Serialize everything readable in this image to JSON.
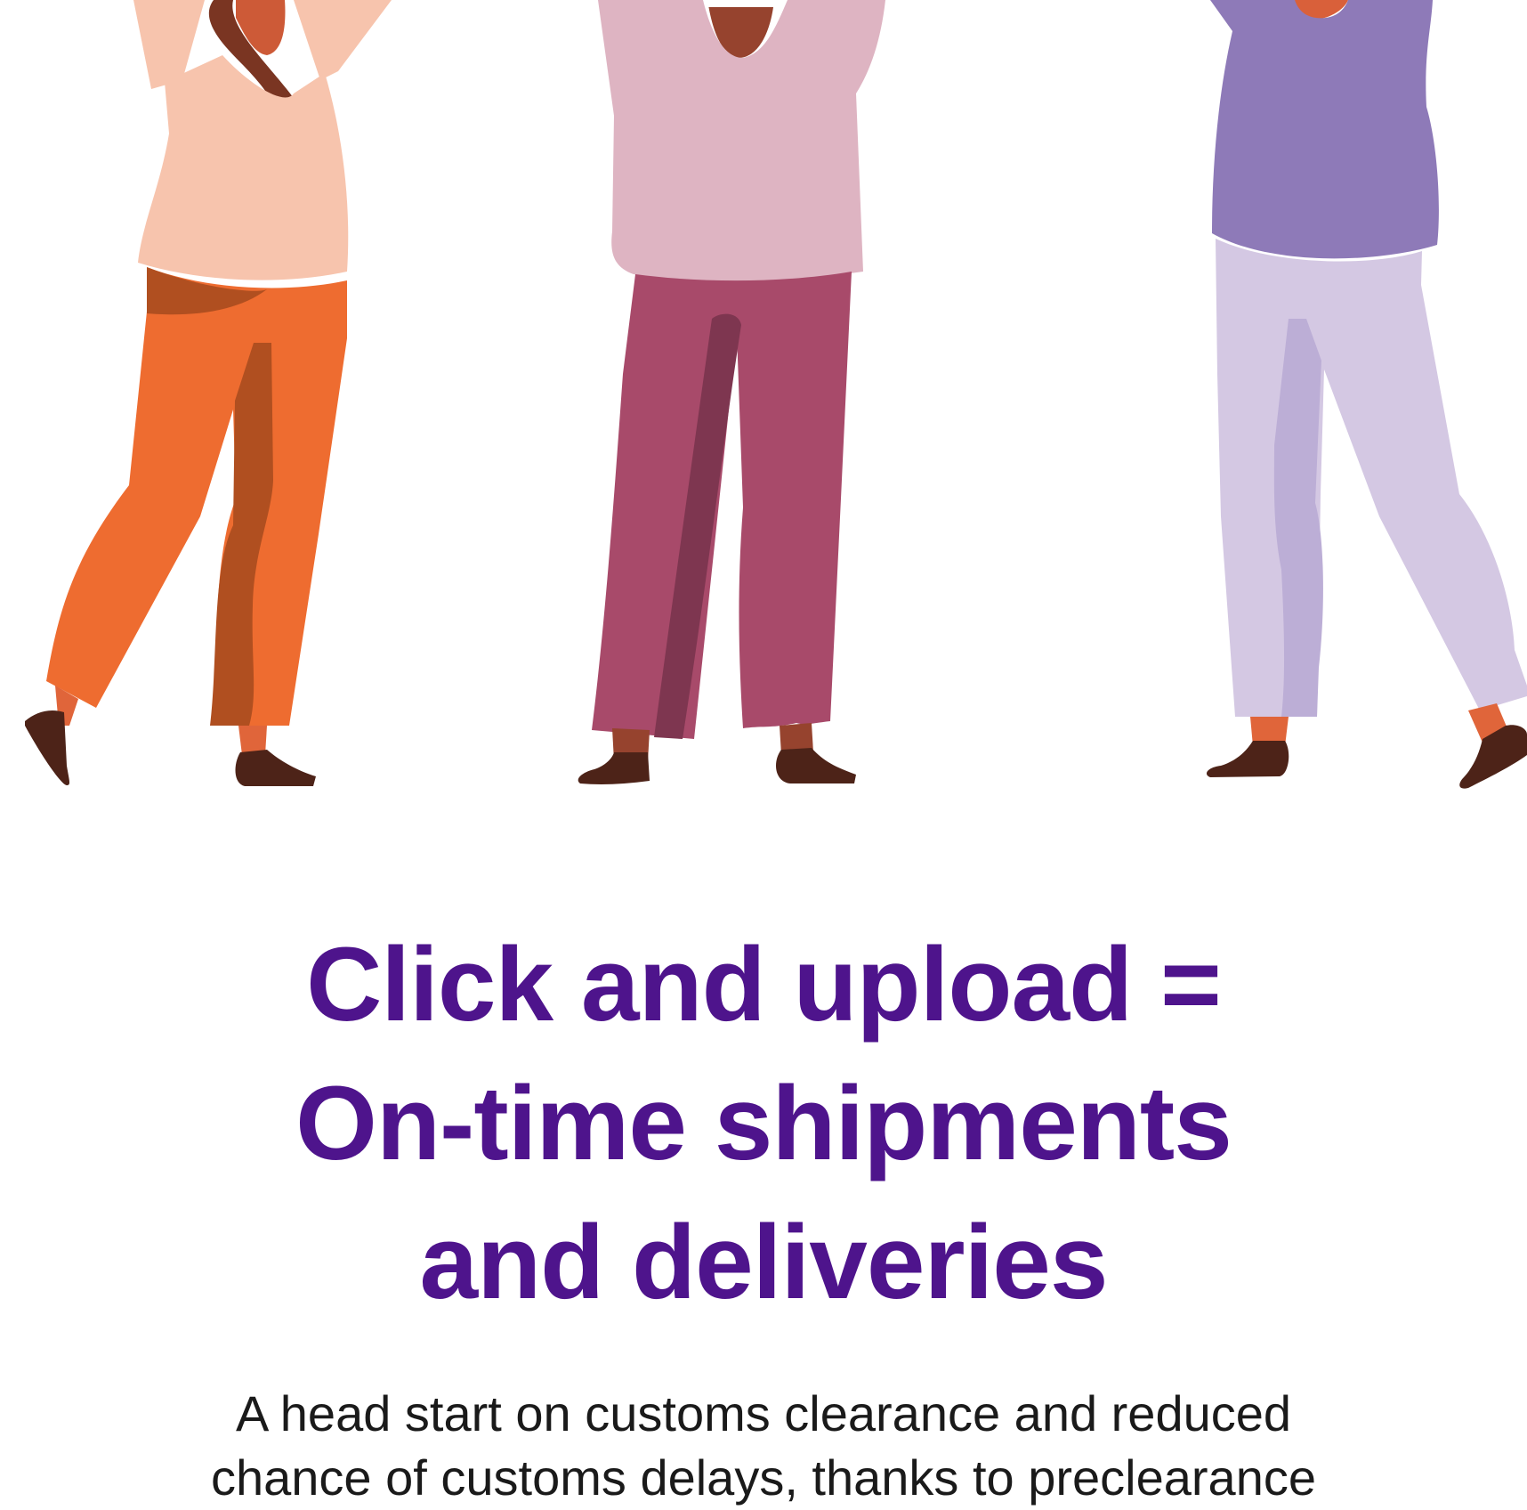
{
  "colors": {
    "heading": "#4e148c",
    "body_text": "#1a1a1a",
    "background": "#ffffff"
  },
  "illustration": {
    "subject": "three people celebrating with raised arms",
    "people": [
      {
        "shirt": "#f7c4ad",
        "pants": "#ee6c30",
        "pants_shadow": "#b04f20"
      },
      {
        "shirt": "#deb4c2",
        "pants": "#a84a6a",
        "pants_shadow": "#7e3650"
      },
      {
        "shirt": "#8e7ab8",
        "pants": "#d4c8e3",
        "pants_shadow": "#bcaed6"
      }
    ]
  },
  "heading": {
    "line1": "Click and upload =",
    "line2": "On-time shipments",
    "line3": "and deliveries"
  },
  "body": {
    "line1": "A head start on customs clearance and reduced",
    "line2": "chance of customs delays, thanks to preclearance"
  }
}
